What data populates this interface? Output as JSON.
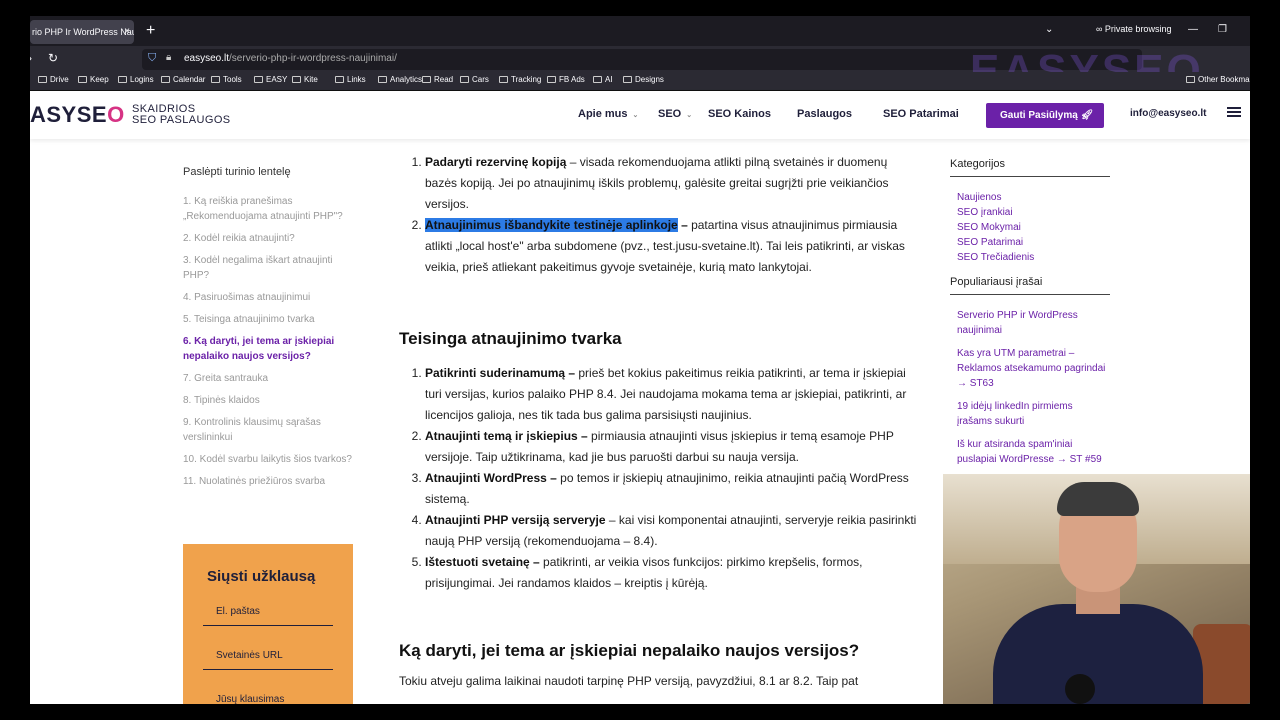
{
  "browser": {
    "tab_title": "rio PHP Ir WordPress Nau",
    "tab_close": "×",
    "new_tab": "+",
    "private_label": "Private browsing",
    "url_domain": "easyseo.lt",
    "url_path": "/serverio-php-ir-wordpress-naujinimai/",
    "watermark": "EASYSEO",
    "bookmarks": [
      "Drive",
      "Keep",
      "Logins",
      "Calendar",
      "Tools",
      "EASY",
      "Kite",
      "Links",
      "Analytics",
      "Read",
      "Cars",
      "Tracking",
      "FB Ads",
      "AI",
      "Designs"
    ],
    "other_bookmarks": "Other Bookmar"
  },
  "site": {
    "logo_main": "ASYSE",
    "logo_o": "O",
    "logo_line1": "SKAIDRIOS",
    "logo_line2": "SEO PASLAUGOS",
    "menu": [
      "Apie mus",
      "SEO",
      "SEO Kainos",
      "Paslaugos",
      "SEO Patarimai"
    ],
    "cta": "Gauti Pasiūlymą",
    "email": "info@easyseo.lt"
  },
  "toc": {
    "title": "Paslėpti turinio lentelę",
    "items": [
      "1. Ką reiškia pranešimas „Rekomenduojama atnaujinti PHP\"?",
      "2. Kodėl reikia atnaujinti?",
      "3. Kodėl negalima iškart atnaujinti PHP?",
      "4. Pasiruošimas atnaujinimui",
      "5. Teisinga atnaujinimo tvarka",
      "6. Ką daryti, jei tema ar įskiepiai nepalaiko naujos versijos?",
      "7. Greita santrauka",
      "8. Tipinės klaidos",
      "9. Kontrolinis klausimų sąrašas verslininkui",
      "10. Kodėl svarbu laikytis šios tvarkos?",
      "11. Nuolatinės priežiūros svarba"
    ],
    "active_index": 5
  },
  "form": {
    "title": "Siųsti užklausą",
    "fields": [
      "El. paštas",
      "Svetainės URL",
      "Jūsų klausimas"
    ]
  },
  "article": {
    "sec1": [
      {
        "bold": "Padaryti rezervinę kopiją",
        "text": " – visada rekomenduojama atlikti pilną svetainės ir duomenų bazės kopiją. Jei po atnaujinimų iškils problemų, galėsite greitai sugrįžti prie veikiančios versijos."
      },
      {
        "bold": "Atnaujinimus išbandykite testinėje aplinkoje",
        "bold_after": " –",
        "text": " patartina visus atnaujinimus pirmiausia atlikti „local host'e\" arba subdomene (pvz., test.jusu-svetaine.lt). Tai leis patikrinti, ar viskas veikia, prieš atliekant pakeitimus gyvoje svetainėje, kurią mato lankytojai."
      }
    ],
    "heading2": "Teisinga atnaujinimo tvarka",
    "sec2": [
      {
        "bold": "Patikrinti suderinamumą –",
        "text": " prieš bet kokius pakeitimus reikia patikrinti, ar tema ir įskiepiai turi versijas, kurios palaiko PHP 8.4. Jei naudojama mokama tema ar įskiepiai, patikrinti, ar licencijos galioja, nes tik tada bus galima parsisiųsti naujinius."
      },
      {
        "bold": "Atnaujinti temą ir įskiepius –",
        "text": " pirmiausia atnaujinti visus įskiepius ir temą esamoje PHP versijoje. Taip užtikrinama, kad jie bus paruošti darbui su nauja versija."
      },
      {
        "bold": "Atnaujinti WordPress –",
        "text": " po temos ir įskiepių atnaujinimo, reikia atnaujinti pačią WordPress sistemą."
      },
      {
        "bold": "Atnaujinti PHP versiją serveryje",
        "text": " – kai visi komponentai atnaujinti, serveryje reikia pasirinkti naują PHP versiją (rekomenduojama – 8.4)."
      },
      {
        "bold": "Ištestuoti svetainę –",
        "text": " patikrinti, ar veikia visos funkcijos: pirkimo krepšelis, formos, prisijungimai. Jei randamos klaidos – kreiptis į kūrėją."
      }
    ],
    "heading3": "Ką daryti, jei tema ar įskiepiai nepalaiko naujos versijos?",
    "para3": "Tokiu atveju galima laikinai naudoti tarpinę PHP versiją, pavyzdžiui, 8.1 ar 8.2. Taip pat"
  },
  "sidebar": {
    "categories_title": "Kategorijos",
    "categories": [
      "Naujienos",
      "SEO įrankiai",
      "SEO Mokymai",
      "SEO Patarimai",
      "SEO Trečiadienis"
    ],
    "popular_title": "Populiariausi įrašai",
    "popular": [
      "Serverio PHP ir WordPress naujinimai",
      "Kas yra UTM parametrai – Reklamos atsekamumo pagrindai → ST63",
      "19 idėjų linkedIn pirmiems įrašams sukurti",
      "Iš kur atsiranda spam'iniai puslapiai WordPresse → ST #59"
    ]
  },
  "colors": {
    "accent": "#6b21a8",
    "highlight": "#2c7be5",
    "form_bg": "#f0a24c"
  }
}
